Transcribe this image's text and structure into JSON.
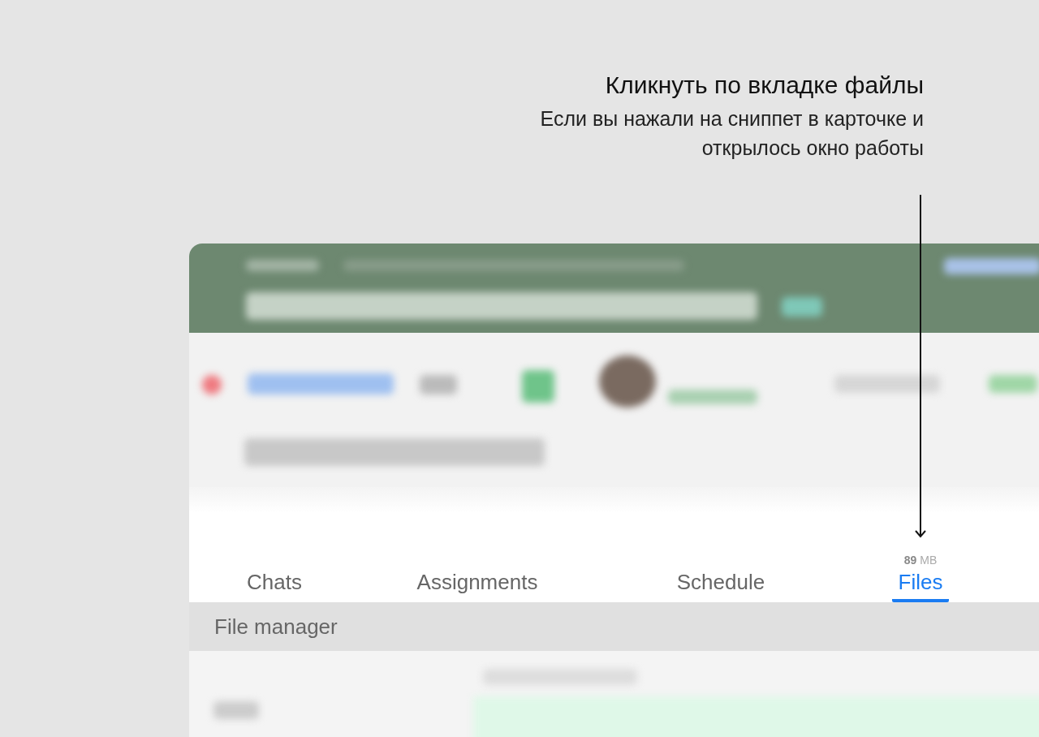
{
  "callout": {
    "title": "Кликнуть по вкладке файлы",
    "body": "Если вы нажали на сниппет в карточке и открылось окно работы"
  },
  "tabs": [
    {
      "label": "Chats",
      "selected": false
    },
    {
      "label": "Assignments",
      "selected": false
    },
    {
      "label": "Schedule",
      "selected": false
    },
    {
      "label": "Files",
      "selected": true,
      "size": "**89** MB"
    }
  ],
  "section": {
    "title": "File manager"
  }
}
